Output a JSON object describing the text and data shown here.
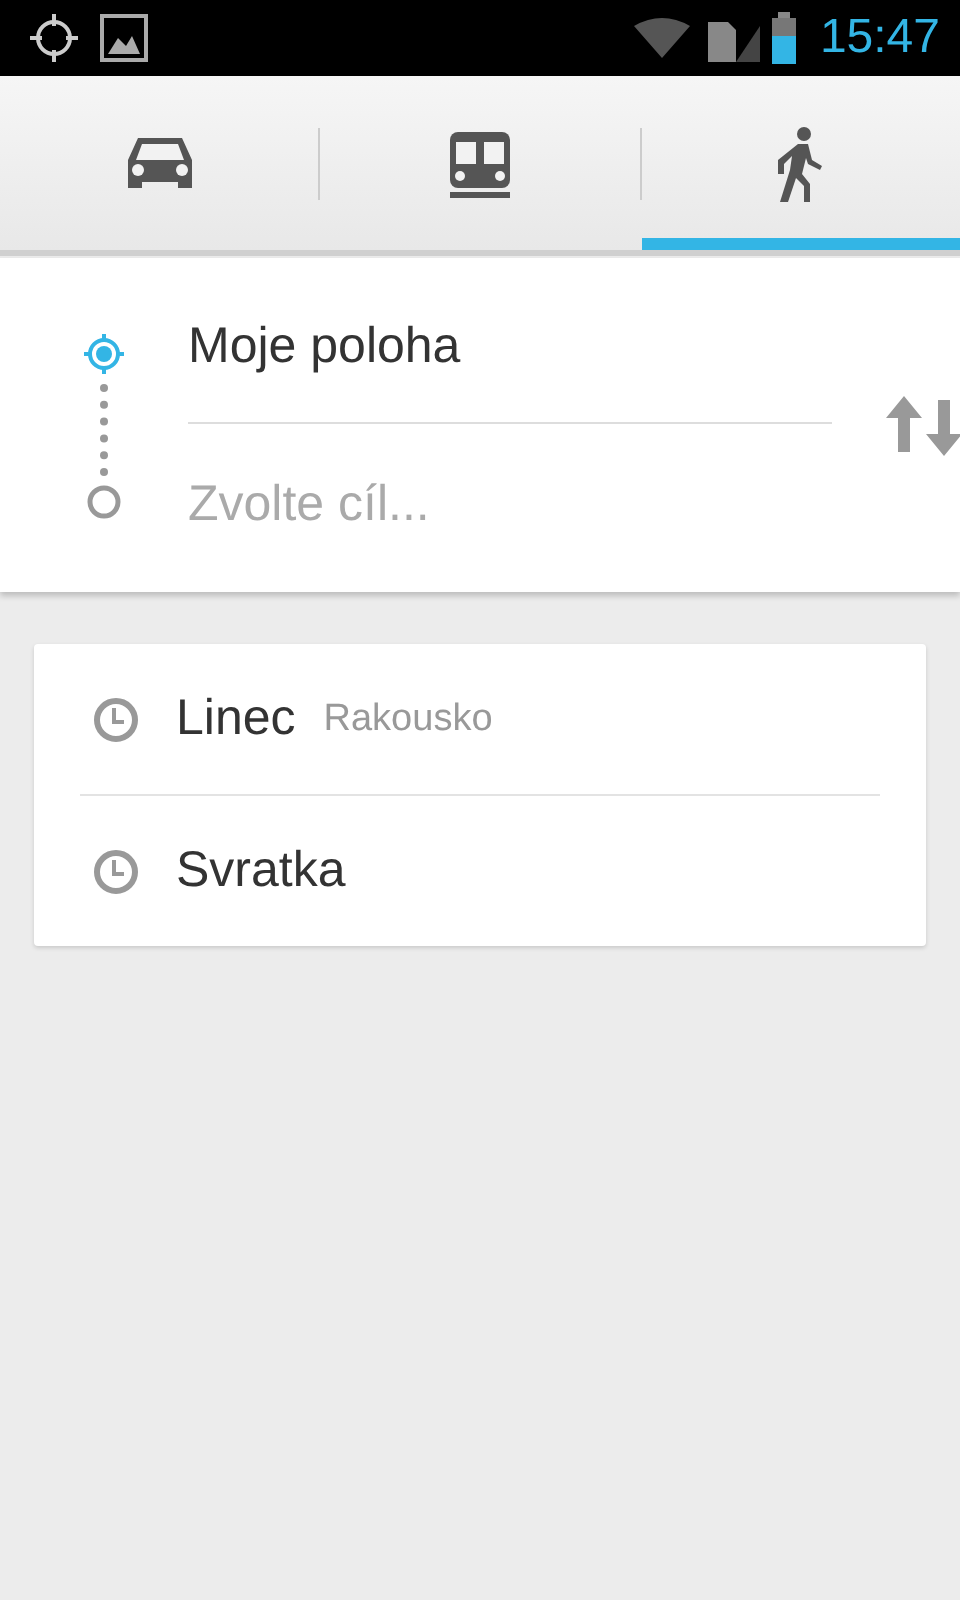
{
  "status_bar": {
    "time": "15:47"
  },
  "tabs": [
    {
      "kind": "car",
      "selected": false
    },
    {
      "kind": "transit",
      "selected": false
    },
    {
      "kind": "walk",
      "selected": true
    }
  ],
  "route": {
    "origin": {
      "value": "Moje poloha"
    },
    "destination": {
      "placeholder": "Zvolte cíl..."
    }
  },
  "recent": [
    {
      "name": "Linec",
      "region": "Rakousko"
    },
    {
      "name": "Svratka"
    }
  ]
}
